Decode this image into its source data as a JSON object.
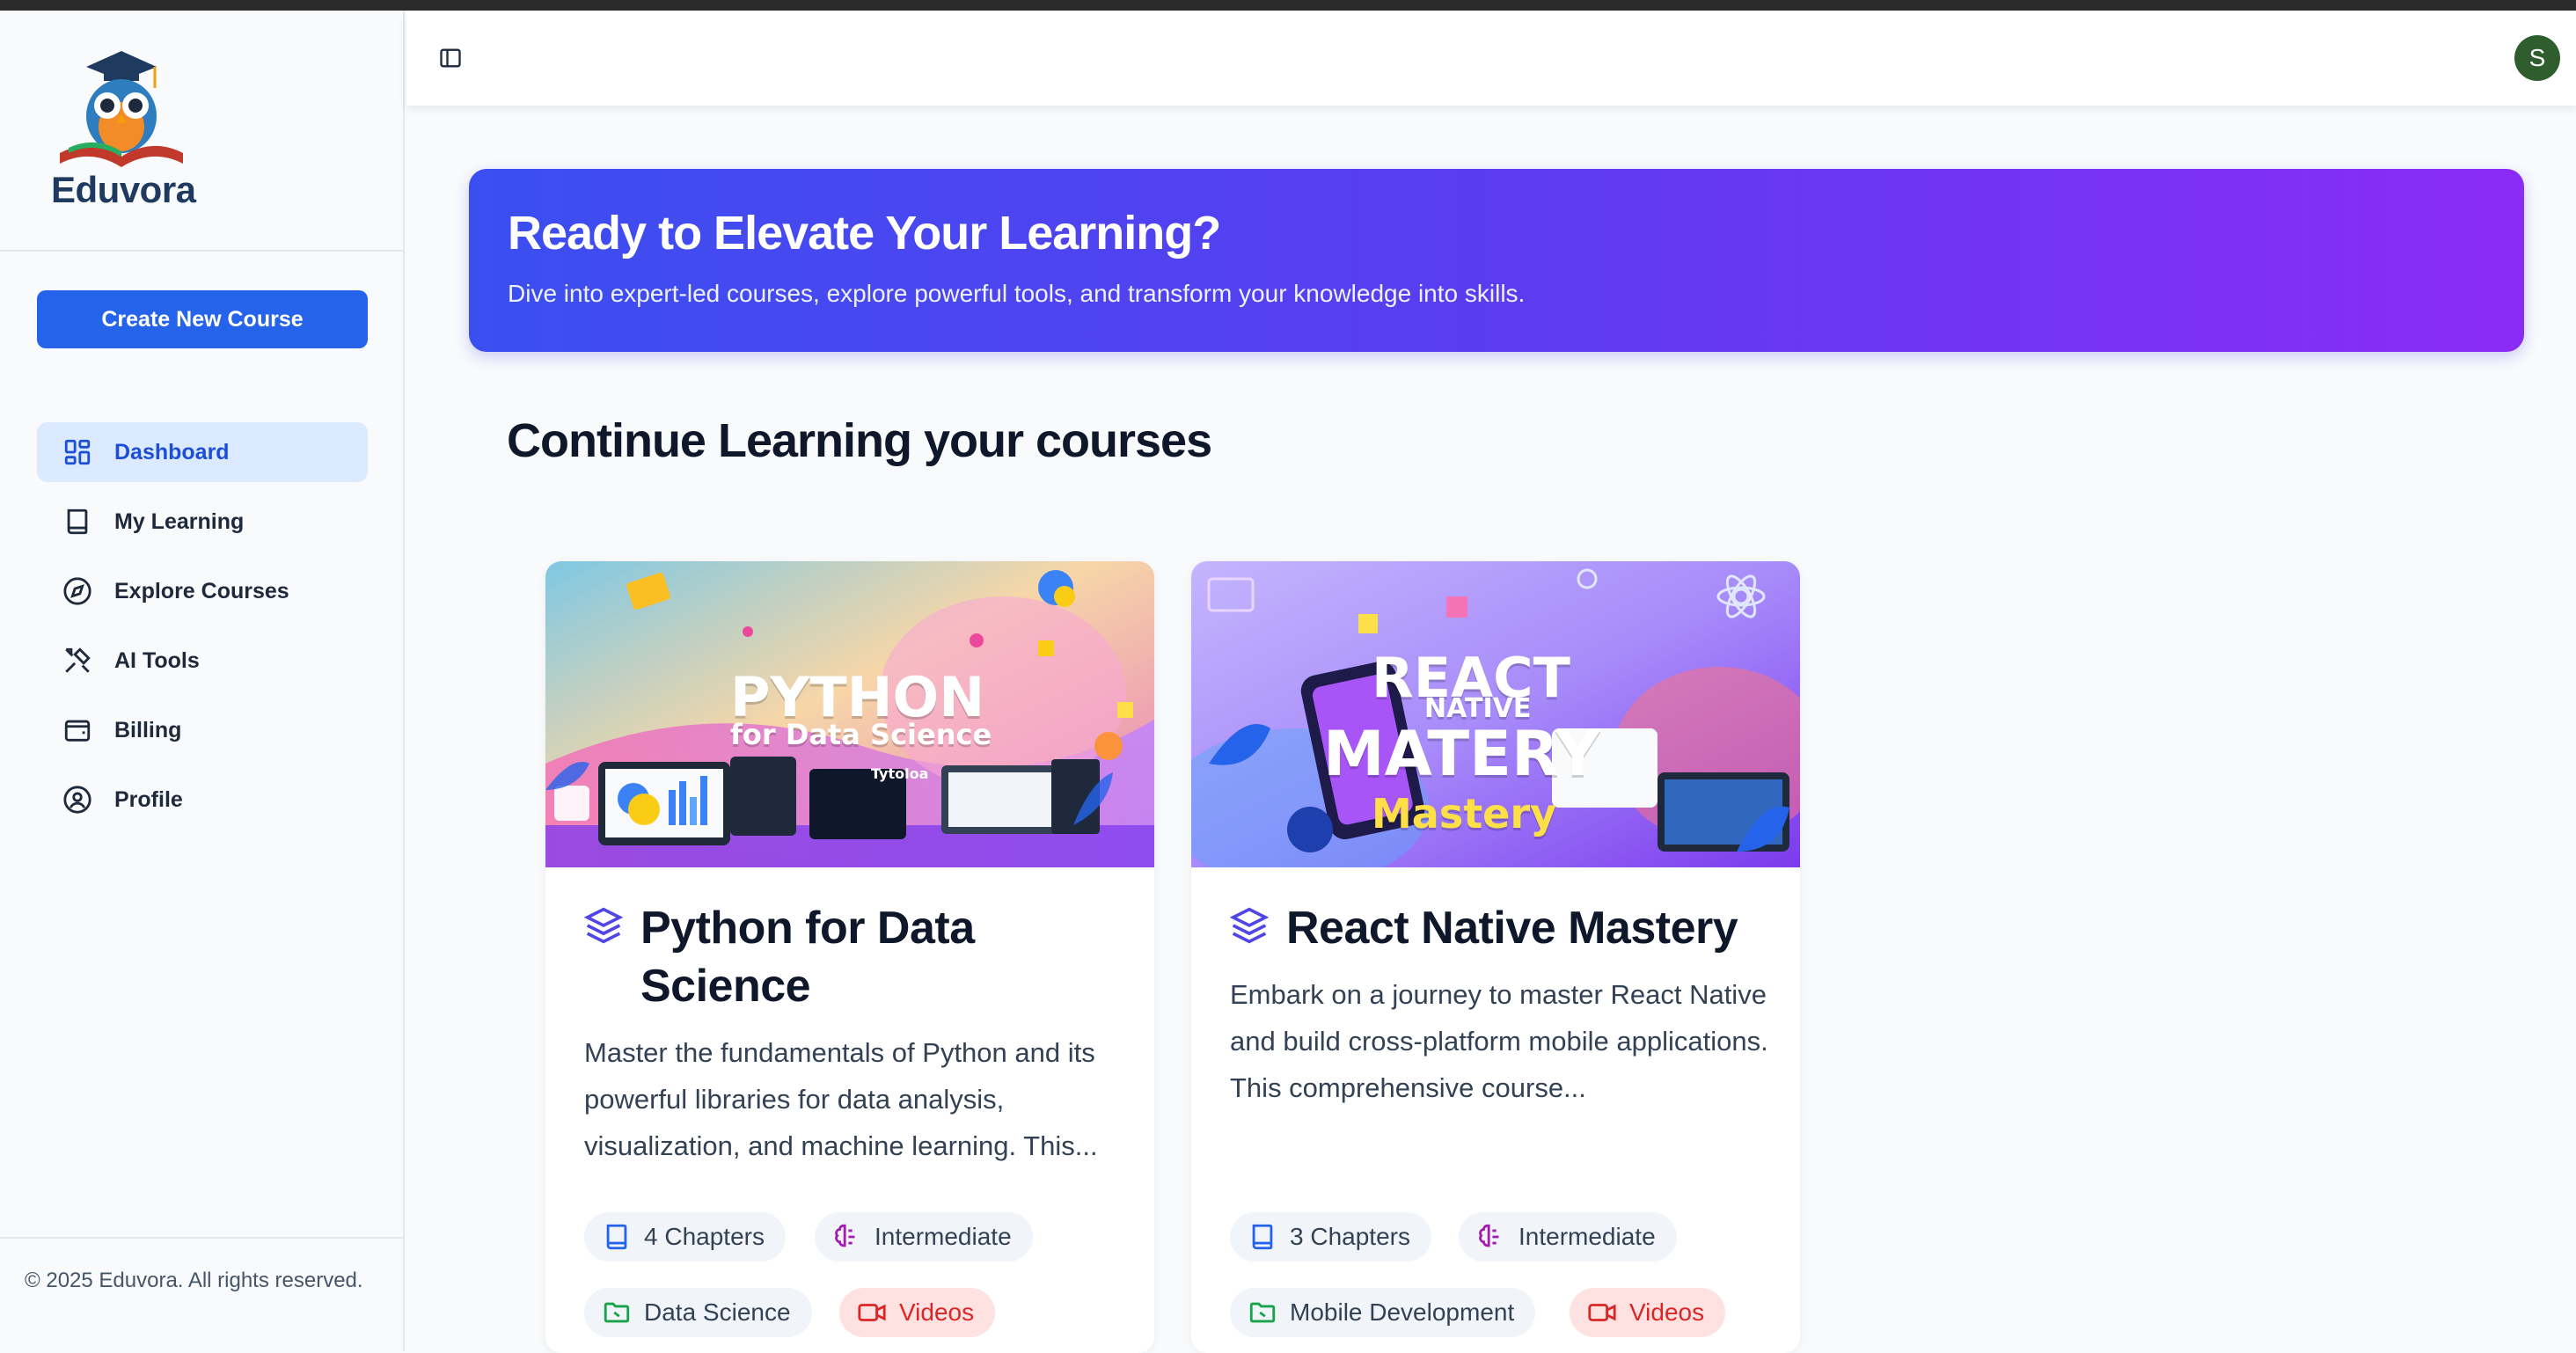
{
  "app": {
    "name": "Eduvora"
  },
  "sidebar": {
    "create_button": "Create New Course",
    "items": [
      {
        "label": "Dashboard",
        "icon": "dashboard-icon",
        "active": true
      },
      {
        "label": "My Learning",
        "icon": "book-icon",
        "active": false
      },
      {
        "label": "Explore Courses",
        "icon": "compass-icon",
        "active": false
      },
      {
        "label": "AI Tools",
        "icon": "tools-icon",
        "active": false
      },
      {
        "label": "Billing",
        "icon": "wallet-icon",
        "active": false
      },
      {
        "label": "Profile",
        "icon": "user-circle-icon",
        "active": false
      }
    ],
    "footer": "© 2025 Eduvora. All rights reserved."
  },
  "header": {
    "avatar_initial": "S"
  },
  "hero": {
    "title": "Ready to Elevate Your Learning?",
    "subtitle": "Dive into expert-led courses, explore powerful tools, and transform your knowledge into skills."
  },
  "section_title": "Continue Learning your courses",
  "courses": [
    {
      "title": "Python for Data Science",
      "image_text": {
        "main": "PYTHON",
        "sub": "for Data Science",
        "screen": "Tytoloa"
      },
      "description": "Master the fundamentals of Python and its powerful libraries for data analysis, visualization, and machine learning. This...",
      "chapters": "4 Chapters",
      "level": "Intermediate",
      "category": "Data Science",
      "format": "Videos"
    },
    {
      "title": "React Native Mastery",
      "image_text": {
        "main": "REACT",
        "mid": "NATIVE",
        "big": "MATERY",
        "sub": "Mastery"
      },
      "description": "Embark on a journey to master React Native and build cross-platform mobile applications. This comprehensive course...",
      "chapters": "3 Chapters",
      "level": "Intermediate",
      "category": "Mobile Development",
      "format": "Videos"
    }
  ],
  "colors": {
    "primary": "#2563eb",
    "hero_start": "#3b4ff0",
    "hero_end": "#8b2cf5",
    "videos_chip": "#dc2626",
    "level_icon": "#a21caf"
  }
}
